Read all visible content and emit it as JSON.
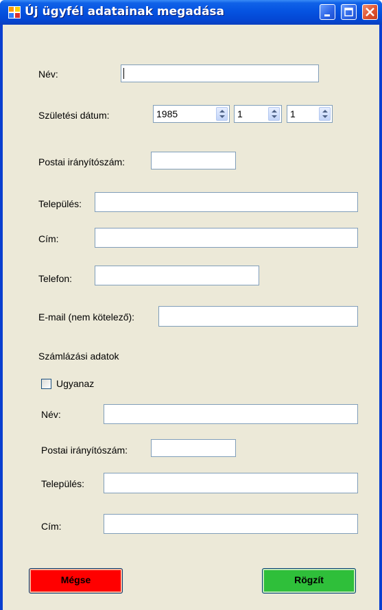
{
  "window": {
    "title": "Új ügyfél adatainak megadása"
  },
  "form": {
    "name_label": "Név:",
    "birth_label": "Születési dátum:",
    "birth_year": "1985",
    "birth_month": "1",
    "birth_day": "1",
    "postal_label": "Postai irányítószám:",
    "city_label": "Település:",
    "address_label": "Cím:",
    "phone_label": "Telefon:",
    "email_label": "E-mail (nem kötelező):"
  },
  "billing": {
    "section_label": "Számlázási adatok",
    "same_label": "Ugyanaz",
    "same_checked": false,
    "name_label": "Név:",
    "postal_label": "Postai irányítószám:",
    "city_label": "Település:",
    "address_label": "Cím:"
  },
  "buttons": {
    "cancel": "Mégse",
    "save": "Rögzít"
  },
  "colors": {
    "cancel_button": "#ff0000",
    "save_button": "#2fbf3a",
    "title_bar": "#0553e1"
  }
}
